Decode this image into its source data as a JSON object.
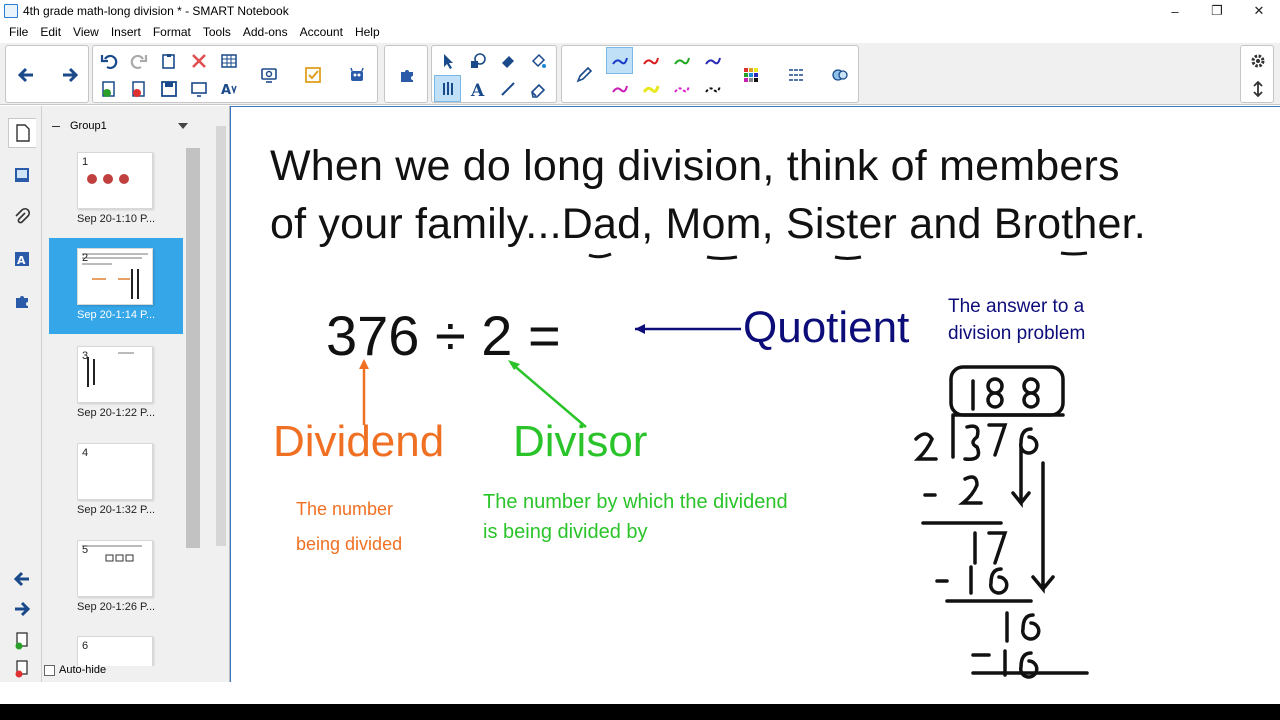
{
  "window": {
    "title": "4th grade math-long division * - SMART Notebook",
    "controls": {
      "minimize": "–",
      "restore": "❐",
      "close": "✕"
    }
  },
  "menu": [
    "File",
    "Edit",
    "View",
    "Insert",
    "Format",
    "Tools",
    "Add-ons",
    "Account",
    "Help"
  ],
  "toolbar": {
    "selected_tools": [
      "select-pen",
      "blue-pen"
    ],
    "pen_colors": [
      "#1a3cc8",
      "#d81e1e",
      "#1ea81e",
      "#2a2ab8",
      "#c81eb4",
      "#e8e81e",
      "#d81ec8",
      "#111111"
    ]
  },
  "sorter": {
    "group_name": "Group1",
    "pages": [
      {
        "num": "1",
        "label": "Sep 20-1:10 P...",
        "selected": false
      },
      {
        "num": "2",
        "label": "Sep 20-1:14 P...",
        "selected": true
      },
      {
        "num": "3",
        "label": "Sep 20-1:22 P...",
        "selected": false
      },
      {
        "num": "4",
        "label": "Sep 20-1:32 P...",
        "selected": false
      },
      {
        "num": "5",
        "label": "Sep 20-1:26 P...",
        "selected": false
      },
      {
        "num": "6",
        "label": "",
        "selected": false
      }
    ],
    "autohide_label": "Auto-hide"
  },
  "slide": {
    "headline_line1": "When we do long division, think of members",
    "headline_line2": "of your family...Dad, Mom, Sister and Brother.",
    "equation": "376 ÷ 2 =",
    "quotient_label": "Quotient",
    "quotient_desc": "The answer to a division problem",
    "dividend_label": "Dividend",
    "dividend_desc_1": "The number",
    "dividend_desc_2": "being divided",
    "divisor_label": "Divisor",
    "divisor_desc": "The number by which the dividend is being divided by",
    "colors": {
      "quotient": "#0d0d7a",
      "dividend": "#f07023",
      "divisor": "#2ac42a",
      "ink": "#111111"
    }
  }
}
